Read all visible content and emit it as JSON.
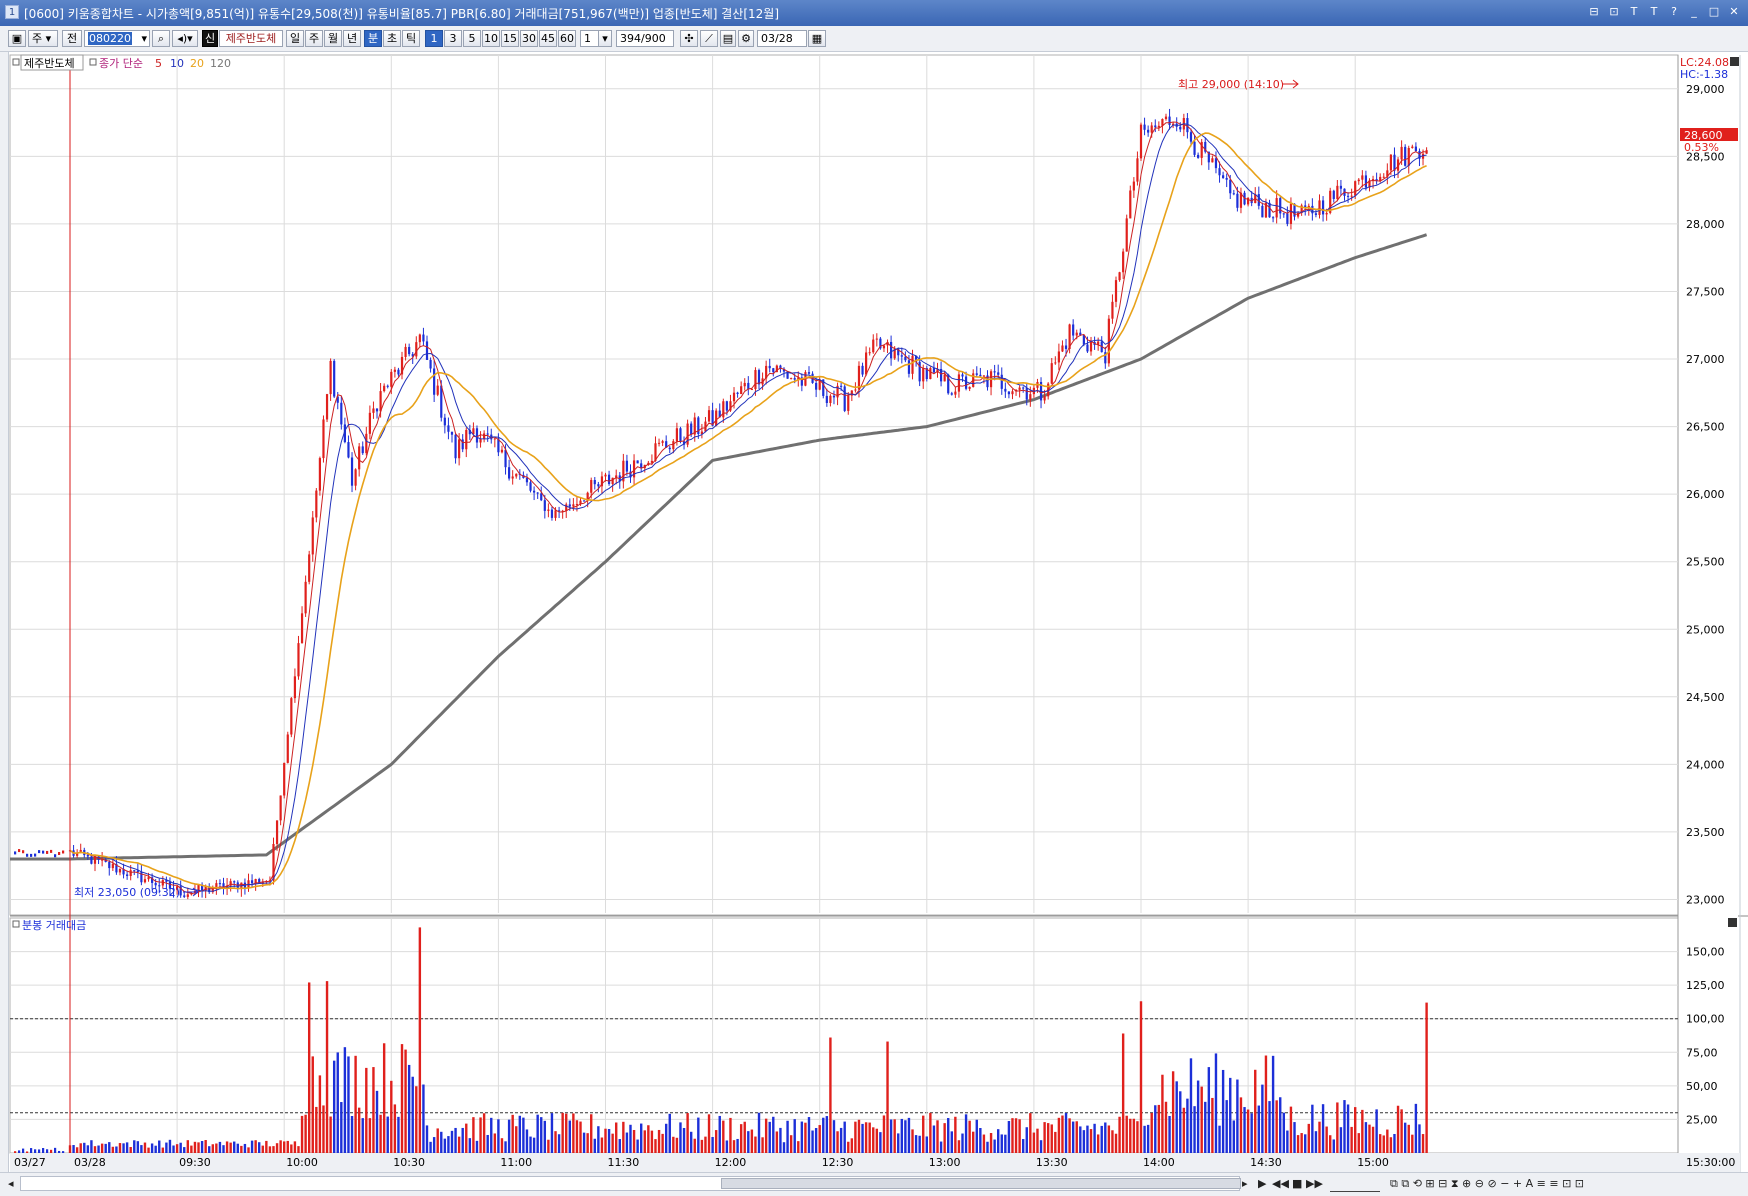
{
  "titlebar": {
    "app_number": "1",
    "title": "[0600] 키움종합차트 - 시가총액[9,851(억)] 유통수[29,508(천)] 유통비율[85.7] PBR[6.80] 거래대금[751,967(백만)] 업종[반도체] 결산[12월]",
    "window_buttons": [
      "⊟",
      "⊡",
      "T",
      "T",
      "?",
      "_",
      "□",
      "✕"
    ]
  },
  "toolbar": {
    "type_select": "주",
    "all_button": "전",
    "stock_code": "080220",
    "new_button": "신",
    "stock_name": "제주반도체",
    "periods": [
      "일",
      "주",
      "월",
      "년",
      "분",
      "초",
      "틱"
    ],
    "selected_period": "분",
    "intervals": [
      "1",
      "3",
      "5",
      "10",
      "15",
      "30",
      "45",
      "60"
    ],
    "selected_interval": "1",
    "multiplier": "1",
    "count": "394",
    "count_total": "/900",
    "date": "03/28"
  },
  "price_panel": {
    "legend_name": "제주반도체",
    "legend_ma": "종가 단순",
    "ma_periods": [
      "5",
      "10",
      "20",
      "120"
    ],
    "ma_colors": [
      "#cc2222",
      "#2233bb",
      "#e8a21a",
      "#777777"
    ],
    "lc_label": "LC:24.08",
    "hc_label": "HC:-1.38",
    "current_price": "28,600",
    "current_change": "0.53%",
    "high_annotation": "최고 29,000 (14:10)",
    "low_annotation": "최저 23,050 (09:32)",
    "y_ticks": [
      "23,000",
      "23,500",
      "24,000",
      "24,500",
      "25,000",
      "25,500",
      "26,000",
      "26,500",
      "27,000",
      "27,500",
      "28,000",
      "28,500",
      "29,000"
    ]
  },
  "volume_panel": {
    "legend": "분봉 거래대금",
    "y_ticks": [
      "25,00",
      "50,00",
      "75,00",
      "100,00",
      "125,00",
      "150,00"
    ]
  },
  "x_axis": {
    "labels": [
      "03/27",
      "03/28",
      "09:30",
      "10:00",
      "10:30",
      "11:00",
      "11:30",
      "12:00",
      "12:30",
      "13:00",
      "13:30",
      "14:00",
      "14:30",
      "15:00",
      "15:30:00"
    ]
  },
  "colors": {
    "up": "#e0201c",
    "down": "#1c2fd8",
    "title_bg": "#3f6bb8",
    "grid": "#dcdcdc",
    "current_price_bg": "#e0201c"
  },
  "chart_data": {
    "type": "candlestick",
    "x_range": [
      "09:00",
      "15:30"
    ],
    "price_ylim": [
      22900,
      29250
    ],
    "key_points": [
      {
        "time": "09:00",
        "price": 23350
      },
      {
        "time": "09:32",
        "price": 23050
      },
      {
        "time": "09:56",
        "price": 23150
      },
      {
        "time": "10:08",
        "price": 25800
      },
      {
        "time": "10:13",
        "price": 26950
      },
      {
        "time": "10:19",
        "price": 26100
      },
      {
        "time": "10:26",
        "price": 26700
      },
      {
        "time": "10:38",
        "price": 27150
      },
      {
        "time": "10:48",
        "price": 26300
      },
      {
        "time": "10:53",
        "price": 26500
      },
      {
        "time": "11:15",
        "price": 25850
      },
      {
        "time": "11:22",
        "price": 25950
      },
      {
        "time": "11:42",
        "price": 26300
      },
      {
        "time": "12:00",
        "price": 26550
      },
      {
        "time": "12:15",
        "price": 26950
      },
      {
        "time": "12:37",
        "price": 26700
      },
      {
        "time": "12:46",
        "price": 27100
      },
      {
        "time": "13:06",
        "price": 26800
      },
      {
        "time": "13:18",
        "price": 26850
      },
      {
        "time": "13:32",
        "price": 26750
      },
      {
        "time": "13:40",
        "price": 27200
      },
      {
        "time": "13:50",
        "price": 27050
      },
      {
        "time": "14:00",
        "price": 28650
      },
      {
        "time": "14:10",
        "price": 28800
      },
      {
        "time": "14:25",
        "price": 28200
      },
      {
        "time": "14:45",
        "price": 28050
      },
      {
        "time": "15:00",
        "price": 28300
      },
      {
        "time": "15:20",
        "price": 28600
      }
    ],
    "ma120_points": [
      {
        "time": "09:00",
        "value": 23300
      },
      {
        "time": "09:55",
        "value": 23330
      },
      {
        "time": "10:30",
        "value": 24000
      },
      {
        "time": "11:00",
        "value": 24800
      },
      {
        "time": "11:30",
        "value": 25500
      },
      {
        "time": "12:00",
        "value": 26250
      },
      {
        "time": "12:30",
        "value": 26400
      },
      {
        "time": "13:00",
        "value": 26500
      },
      {
        "time": "13:30",
        "value": 26700
      },
      {
        "time": "14:00",
        "value": 27000
      },
      {
        "time": "14:30",
        "value": 27450
      },
      {
        "time": "15:00",
        "value": 27750
      },
      {
        "time": "15:20",
        "value": 27920
      }
    ],
    "volume_ylim": [
      0,
      175
    ],
    "volume_ref_lines": [
      30,
      100
    ],
    "volume_spikes": [
      {
        "time": "10:07",
        "value": 127
      },
      {
        "time": "10:12",
        "value": 128
      },
      {
        "time": "10:38",
        "value": 168
      },
      {
        "time": "12:33",
        "value": 86
      },
      {
        "time": "12:49",
        "value": 83
      },
      {
        "time": "13:55",
        "value": 89
      },
      {
        "time": "14:00",
        "value": 113
      },
      {
        "time": "15:20",
        "value": 112
      }
    ]
  }
}
